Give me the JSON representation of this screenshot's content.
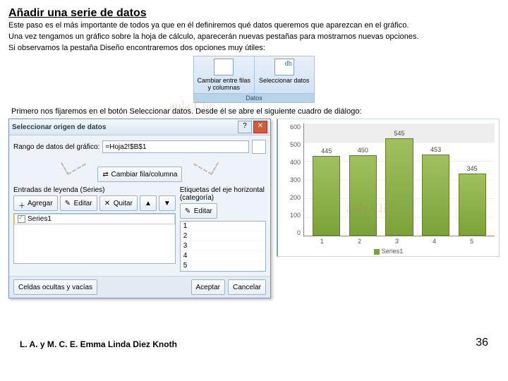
{
  "title": "Añadir una serie de datos",
  "intro": {
    "p1": "Este paso es el más importante de todos ya que en él definiremos qué datos queremos que aparezcan en el gráfico.",
    "p2": "Una vez tengamos un gráfico sobre la hoja de cálculo, aparecerán nuevas pestañas para mostrarnos nuevas opciones.",
    "p3": "Si observamos la pestaña Diseño encontraremos dos opciones muy útiles:"
  },
  "ribbon": {
    "switch_label": "Cambiar entre filas y columnas",
    "select_label": "Seleccionar datos",
    "group": "Datos"
  },
  "midtext": "Primero nos fijaremos en el botón Seleccionar datos. Desde él se abre el siguiente cuadro de diálogo:",
  "dialog": {
    "title": "Seleccionar origen de datos",
    "range_label": "Rango de datos del gráfico:",
    "range_value": "=Hoja2!$B$1",
    "switch_btn": "Cambiar fila/columna",
    "legend_label": "Entradas de leyenda (Series)",
    "axis_label": "Etiquetas del eje horizontal (categoría)",
    "add": "Agregar",
    "edit": "Editar",
    "remove": "Quitar",
    "series1": "Series1",
    "axis_items": [
      "1",
      "2",
      "3",
      "4",
      "5"
    ],
    "hidden_btn": "Celdas ocultas y vacías",
    "ok": "Aceptar",
    "cancel": "Cancelar"
  },
  "chart_data": {
    "type": "bar",
    "categories": [
      "1",
      "2",
      "3",
      "4",
      "5"
    ],
    "values": [
      445,
      450,
      545,
      453,
      345
    ],
    "series_name": "Series1",
    "ylim": [
      0,
      600
    ],
    "yticks": [
      "0",
      "100",
      "200",
      "300",
      "400",
      "500",
      "600"
    ]
  },
  "watermark": "aula Clic",
  "footer": {
    "author": "L. A. y M. C. E. Emma Linda Diez Knoth",
    "page": "36"
  }
}
